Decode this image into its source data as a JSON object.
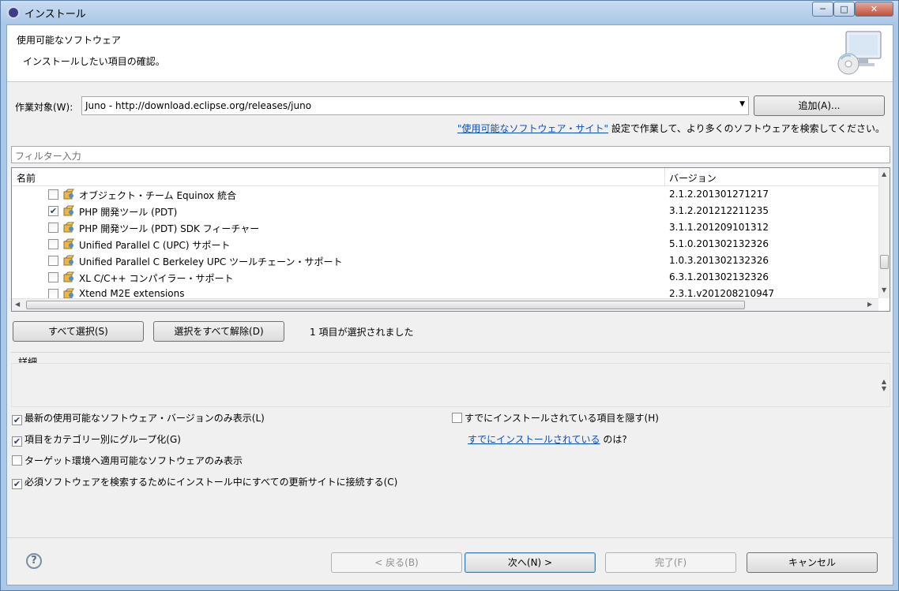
{
  "window": {
    "title": "インストール",
    "controls": {
      "minimize": "─",
      "maximize": "□",
      "close": "✕"
    }
  },
  "banner": {
    "title": "使用可能なソフトウェア",
    "subtitle": "インストールしたい項目の確認。"
  },
  "work_with": {
    "label": "作業対象(W):",
    "value": "Juno - http://download.eclipse.org/releases/juno",
    "add_button": "追加(A)..."
  },
  "sites_hint": {
    "link": "\"使用可能なソフトウェア・サイト\"",
    "text": " 設定で作業して、より多くのソフトウェアを検索してください。"
  },
  "filter": {
    "placeholder": "フィルター入力"
  },
  "table": {
    "columns": [
      "名前",
      "バージョン"
    ],
    "rows": [
      {
        "name": "オブジェクト・チーム Equinox 統合",
        "version": "2.1.2.201301271217",
        "checked": false
      },
      {
        "name": "PHP 開発ツール (PDT)",
        "version": "3.1.2.201212211235",
        "checked": true
      },
      {
        "name": "PHP 開発ツール (PDT) SDK フィーチャー",
        "version": "3.1.1.201209101312",
        "checked": false
      },
      {
        "name": "Unified Parallel C (UPC) サポート",
        "version": "5.1.0.201302132326",
        "checked": false
      },
      {
        "name": "Unified Parallel C Berkeley UPC ツールチェーン・サポート",
        "version": "1.0.3.201302132326",
        "checked": false
      },
      {
        "name": "XL C/C++ コンパイラー・サポート",
        "version": "6.3.1.201302132326",
        "checked": false
      },
      {
        "name": "Xtend M2E extensions",
        "version": "2.3.1.v201208210947",
        "checked": false
      }
    ]
  },
  "selection": {
    "select_all": "すべて選択(S)",
    "deselect_all": "選択をすべて解除(D)",
    "status": "1 項目が選択されました"
  },
  "details": {
    "label": "詳細"
  },
  "options": {
    "latest_only": "最新の使用可能なソフトウェア・バージョンのみ表示(L)",
    "group_by_category": "項目をカテゴリー別にグループ化(G)",
    "target_env_only": "ターゲット環境へ適用可能なソフトウェアのみ表示",
    "contact_all_sites": "必須ソフトウェアを検索するためにインストール中にすべての更新サイトに接続する(C)",
    "hide_installed": "すでにインストールされている項目を隠す(H)",
    "already_installed_link": "すでにインストールされている",
    "already_installed_suffix": " のは?"
  },
  "footer": {
    "help": "?",
    "back": "< 戻る(B)",
    "next": "次へ(N) >",
    "finish": "完了(F)",
    "cancel": "キャンセル"
  }
}
